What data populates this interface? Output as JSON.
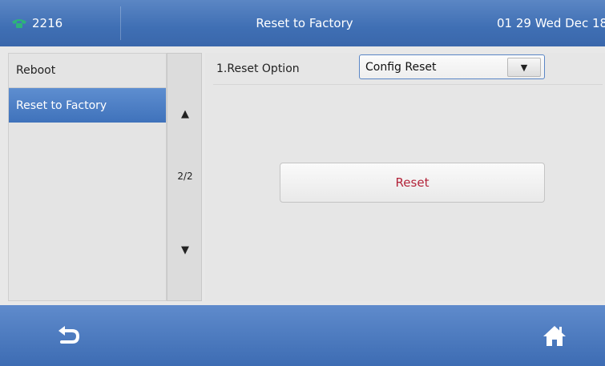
{
  "titlebar": {
    "extension": "2216",
    "title": "Reset to Factory",
    "datetime": "01 29 Wed Dec 18"
  },
  "sidebar": {
    "items": [
      {
        "label": "Reboot",
        "active": false
      },
      {
        "label": "Reset to Factory",
        "active": true
      }
    ]
  },
  "scroller": {
    "up": "▲",
    "page": "2/2",
    "down": "▼"
  },
  "content": {
    "option_label": "1.Reset Option",
    "option_value": "Config Reset",
    "dropdown_arrow": "▼",
    "reset_label": "Reset"
  },
  "icons": {
    "line_status": "phone-handset-icon",
    "back": "back-arrow-icon",
    "home": "home-icon"
  },
  "colors": {
    "titlebar": "#4574b8",
    "active_item": "#4a7cc3",
    "reset_text": "#b3243a",
    "phone_icon": "#2db37a"
  }
}
